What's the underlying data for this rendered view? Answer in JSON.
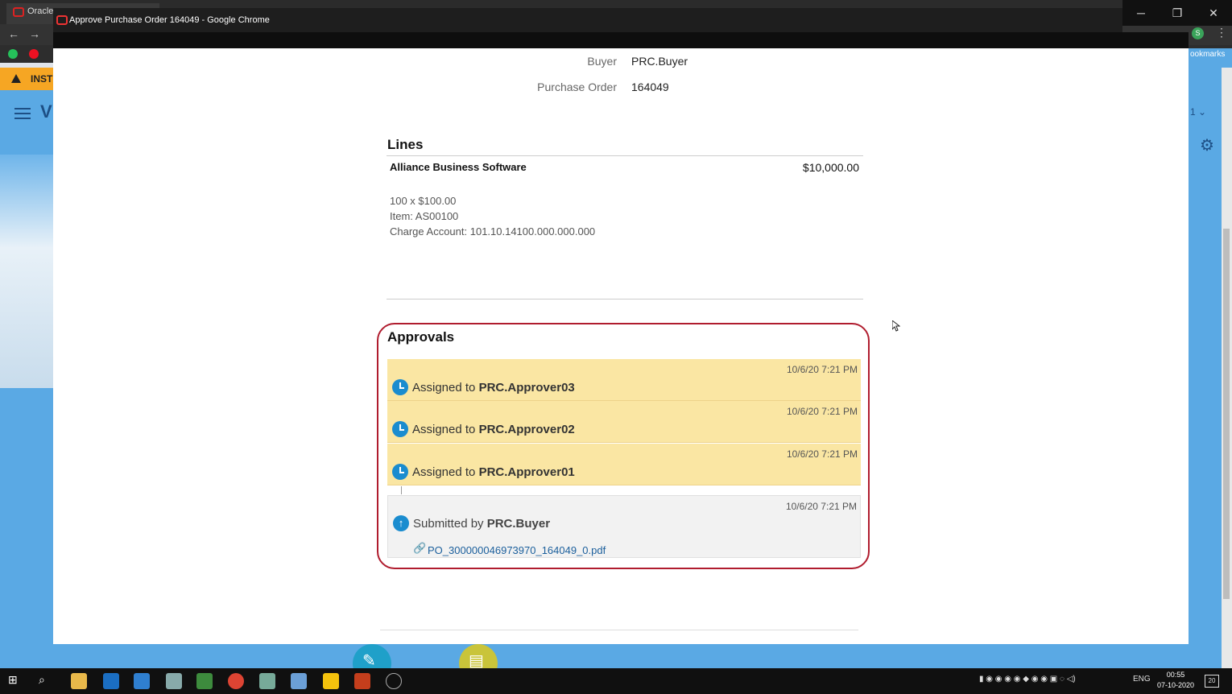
{
  "browser": {
    "background_tab_label": "Oracle",
    "popup_title": "Approve Purchase Order 164049 - Google Chrome",
    "bookmarks_label": "ookmarks",
    "profile_initial": "S",
    "warning_text": "INST",
    "app_logo": "V",
    "right_fragment": "1"
  },
  "header_fields": {
    "buyer_label": "Buyer",
    "buyer_value": "PRC.Buyer",
    "po_label": "Purchase Order",
    "po_value": "164049"
  },
  "lines": {
    "title": "Lines",
    "item": {
      "name": "Alliance Business Software",
      "amount": "$10,000.00",
      "quantity_price": "100 x $100.00",
      "item_code": "Item: AS00100",
      "charge_account": "Charge Account: 101.10.14100.000.000.000"
    }
  },
  "approvals": {
    "title": "Approvals",
    "entries": [
      {
        "timestamp": "10/6/20 7:21 PM",
        "prefix": "Assigned to",
        "name": "PRC.Approver03"
      },
      {
        "timestamp": "10/6/20 7:21 PM",
        "prefix": "Assigned to",
        "name": "PRC.Approver02"
      },
      {
        "timestamp": "10/6/20 7:21 PM",
        "prefix": "Assigned to",
        "name": "PRC.Approver01"
      }
    ],
    "submitted": {
      "timestamp": "10/6/20 7:21 PM",
      "prefix": "Submitted by",
      "name": "PRC.Buyer",
      "attachment": "PO_300000046973970_164049_0.pdf"
    }
  },
  "taskbar": {
    "language": "ENG",
    "time": "00:55",
    "date": "07-10-2020",
    "notification_count": "20"
  },
  "colors": {
    "approval_pending_bg": "#fae6a3",
    "highlight_border": "#b01c2e",
    "app_blue": "#5aa9e4",
    "warning_bar": "#f6a623",
    "link": "#1b5f9c"
  }
}
